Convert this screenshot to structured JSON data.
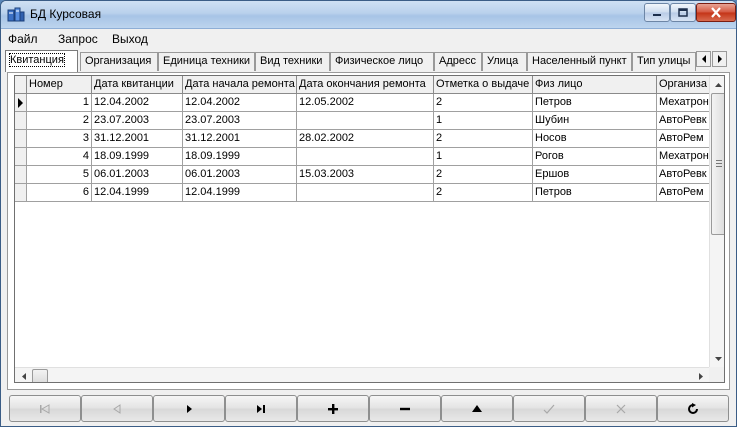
{
  "window": {
    "title": "БД Курсовая"
  },
  "menu": [
    {
      "label": "Файл"
    },
    {
      "label": "Запрос"
    },
    {
      "label": "Выход"
    }
  ],
  "tabs": [
    {
      "label": "Квитанция",
      "active": true
    },
    {
      "label": "Организация"
    },
    {
      "label": "Единица техники"
    },
    {
      "label": "Вид техники"
    },
    {
      "label": "Физическое лицо"
    },
    {
      "label": "Адресс"
    },
    {
      "label": "Улица"
    },
    {
      "label": "Населенный пункт"
    },
    {
      "label": "Тип улицы"
    }
  ],
  "grid": {
    "columns": [
      "Номер",
      "Дата квитанции",
      "Дата начала ремонта",
      "Дата окончания ремонта",
      "Отметка о выдаче",
      "Физ лицо",
      "Организа"
    ],
    "rows": [
      [
        "1",
        "12.04.2002",
        "12.04.2002",
        "12.05.2002",
        "2",
        "Петров",
        "Мехатрон"
      ],
      [
        "2",
        "23.07.2003",
        "23.07.2003",
        "",
        "1",
        "Шубин",
        "АвтоРевк"
      ],
      [
        "3",
        "31.12.2001",
        "31.12.2001",
        "28.02.2002",
        "2",
        "Носов",
        "АвтоРем"
      ],
      [
        "4",
        "18.09.1999",
        "18.09.1999",
        "",
        "1",
        "Рогов",
        "Мехатрон"
      ],
      [
        "5",
        "06.01.2003",
        "06.01.2003",
        "15.03.2003",
        "2",
        "Ершов",
        "АвтоРевк"
      ],
      [
        "6",
        "12.04.1999",
        "12.04.1999",
        "",
        "2",
        "Петров",
        "АвтоРем"
      ]
    ],
    "current_row": 1
  },
  "navigator": [
    {
      "name": "first-record-button",
      "glyph": "|◀",
      "enabled": false
    },
    {
      "name": "prior-record-button",
      "glyph": "◀",
      "enabled": false
    },
    {
      "name": "next-record-button",
      "glyph": "▶",
      "enabled": true
    },
    {
      "name": "last-record-button",
      "glyph": "▶|",
      "enabled": true
    },
    {
      "name": "insert-record-button",
      "glyph": "+",
      "enabled": true
    },
    {
      "name": "delete-record-button",
      "glyph": "−",
      "enabled": true
    },
    {
      "name": "edit-record-button",
      "glyph": "▲",
      "enabled": true
    },
    {
      "name": "post-edit-button",
      "glyph": "✓",
      "enabled": false
    },
    {
      "name": "cancel-edit-button",
      "glyph": "✕",
      "enabled": false
    },
    {
      "name": "refresh-data-button",
      "glyph": "↻",
      "enabled": true
    }
  ]
}
